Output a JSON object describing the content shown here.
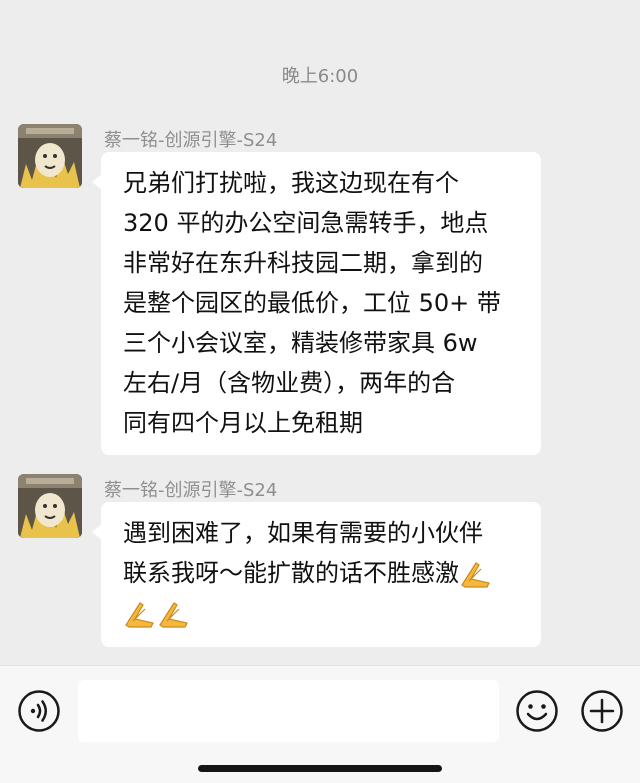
{
  "chat": {
    "timestamp": "晚上6:00",
    "messages": [
      {
        "sender": "蔡一铭-创源引擎-S24",
        "lines": [
          "兄弟们打扰啦，我这边现在有个",
          "320 平的办公空间急需转手，地点",
          "非常好在东升科技园二期，拿到的",
          "是整个园区的最低价，工位 50+ 带",
          "三个小会议室，精装修带家具 6w",
          "左右/月（含物业费），两年的合",
          "同有四个月以上免租期"
        ]
      },
      {
        "sender": "蔡一铭-创源引擎-S24",
        "lines": [
          "遇到困难了，如果有需要的小伙伴",
          "联系我呀～能扩散的话不胜感激"
        ],
        "emoji": "folded-hands-emoji"
      }
    ]
  },
  "input_bar": {
    "voice_icon": "voice-icon",
    "emoji_icon": "smiley-icon",
    "plus_icon": "plus-icon"
  }
}
